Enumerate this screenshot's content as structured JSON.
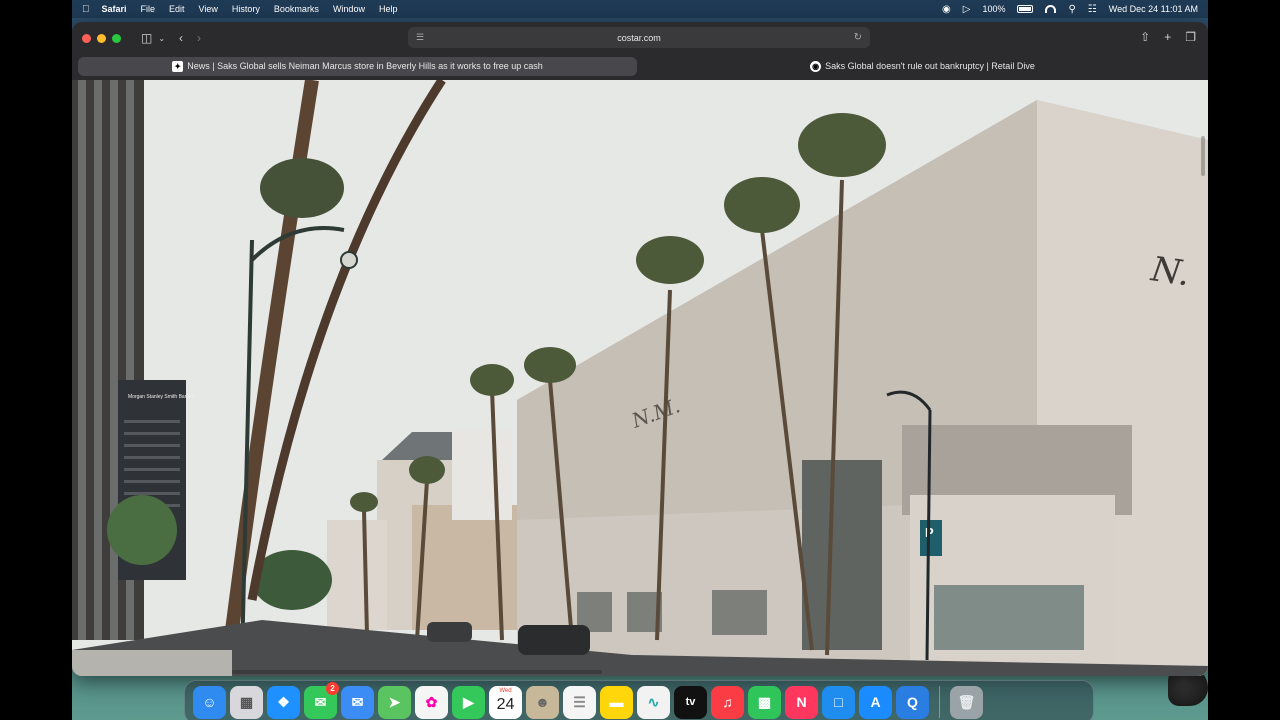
{
  "menubar": {
    "app_name": "Safari",
    "items": [
      "File",
      "Edit",
      "View",
      "History",
      "Bookmarks",
      "Window",
      "Help"
    ],
    "battery": "100%",
    "datetime": "Wed Dec 24  11:01 AM"
  },
  "browser": {
    "url": "costar.com",
    "tabs": [
      {
        "title": "News | Saks Global sells Neiman Marcus store in Beverly Hills as it works to free up cash",
        "active": true
      },
      {
        "title": "Saks Global doesn't rule out bankruptcy | Retail Dive",
        "active": false
      }
    ]
  },
  "photo": {
    "sign_building": "Morgan Stanley Smith Barney",
    "parking_sign": "P"
  },
  "dock": {
    "items": [
      {
        "name": "finder",
        "color": "#2f8bf0"
      },
      {
        "name": "launchpad",
        "color": "#d8d8dc"
      },
      {
        "name": "safari",
        "color": "#1e90ff"
      },
      {
        "name": "messages",
        "color": "#34c759",
        "badge": "2"
      },
      {
        "name": "mail",
        "color": "#3b8df5"
      },
      {
        "name": "maps",
        "color": "#5ac460"
      },
      {
        "name": "photos",
        "color": "#f5f5f5"
      },
      {
        "name": "facetime",
        "color": "#34c759"
      },
      {
        "name": "calendar",
        "color": "#ffffff",
        "month": "Wed",
        "day": "24"
      },
      {
        "name": "contacts",
        "color": "#c8b89a"
      },
      {
        "name": "reminders",
        "color": "#f5f5f5"
      },
      {
        "name": "notes",
        "color": "#ffd60a"
      },
      {
        "name": "freeform",
        "color": "#f2f2f2"
      },
      {
        "name": "apple-tv",
        "color": "#111111",
        "label": "tv"
      },
      {
        "name": "music",
        "color": "#fc3c44"
      },
      {
        "name": "numbers",
        "color": "#30c55a"
      },
      {
        "name": "news",
        "color": "#ff375f"
      },
      {
        "name": "keynote",
        "color": "#1f8cf0"
      },
      {
        "name": "app-store",
        "color": "#1a8cff"
      },
      {
        "name": "quicktime",
        "color": "#2a7de1"
      }
    ],
    "trash_color": "#9aa3a8"
  }
}
